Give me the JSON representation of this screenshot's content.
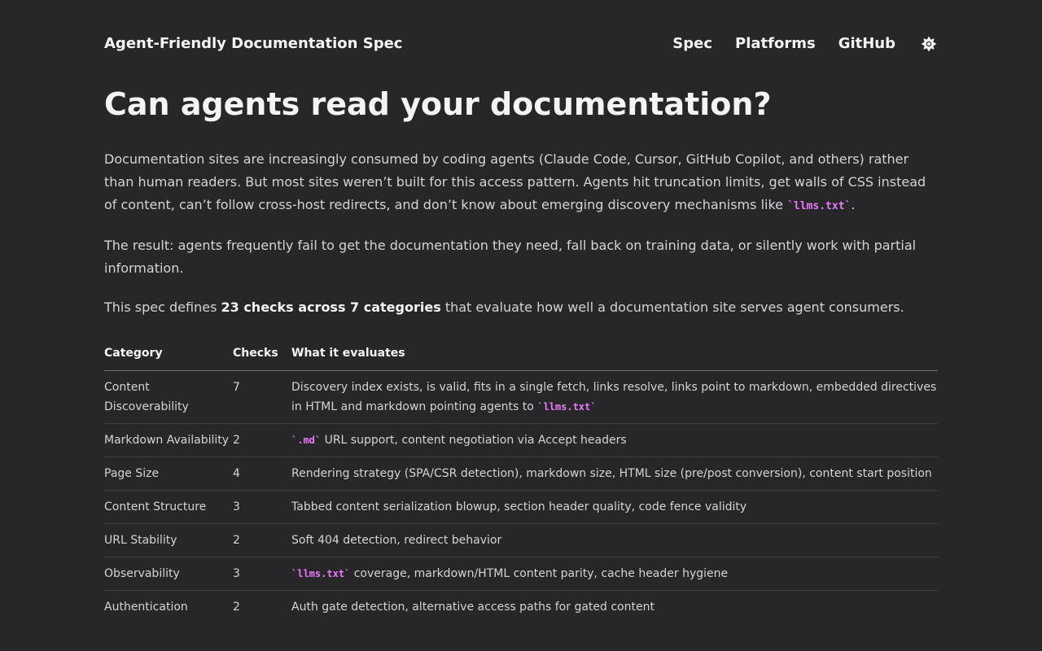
{
  "header": {
    "brand": "Agent-Friendly Documentation Spec",
    "nav": [
      "Spec",
      "Platforms",
      "GitHub"
    ],
    "theme_icon": "sun-icon"
  },
  "main": {
    "title": "Can agents read your documentation?",
    "p1_text": "Documentation sites are increasingly consumed by coding agents (Claude Code, Cursor, GitHub Copilot, and others) rather than human readers. But most sites weren’t built for this access pattern. Agents hit truncation limits, get walls of CSS instead of content, can’t follow cross-host redirects, and don’t know about emerging discovery mechanisms like ",
    "p1_code": "`llms.txt`",
    "p1_end": ".",
    "p2": "The result: agents frequently fail to get the documentation they need, fall back on training data, or silently work with partial information.",
    "p3_start": "This spec defines ",
    "p3_bold": "23 checks across 7 categories",
    "p3_end": " that evaluate how well a documentation site serves agent consumers."
  },
  "table": {
    "headers": [
      "Category",
      "Checks",
      "What it evaluates"
    ],
    "rows": [
      {
        "category": "Content Discoverability",
        "checks": "7",
        "pre": "Discovery index exists, is valid, fits in a single fetch, links resolve, links point to markdown, embedded directives in HTML and markdown pointing agents to ",
        "code": "`llms.txt`",
        "post": ""
      },
      {
        "category": "Markdown Availability",
        "checks": "2",
        "pre": "",
        "code": "`.md`",
        "post": " URL support, content negotiation via Accept headers"
      },
      {
        "category": "Page Size",
        "checks": "4",
        "pre": "Rendering strategy (SPA/CSR detection), markdown size, HTML size (pre/post conversion), content start position",
        "code": "",
        "post": ""
      },
      {
        "category": "Content Structure",
        "checks": "3",
        "pre": "Tabbed content serialization blowup, section header quality, code fence validity",
        "code": "",
        "post": ""
      },
      {
        "category": "URL Stability",
        "checks": "2",
        "pre": "Soft 404 detection, redirect behavior",
        "code": "",
        "post": ""
      },
      {
        "category": "Observability",
        "checks": "3",
        "pre": "",
        "code": "`llms.txt`",
        "post": " coverage, markdown/HTML content parity, cache header hygiene"
      },
      {
        "category": "Authentication",
        "checks": "2",
        "pre": "Auth gate detection, alternative access paths for gated content",
        "code": "",
        "post": ""
      }
    ]
  },
  "colors": {
    "background": "#27272a",
    "text": "#d4d4d8",
    "heading": "#f4f4f5",
    "code": "#e879f9"
  }
}
